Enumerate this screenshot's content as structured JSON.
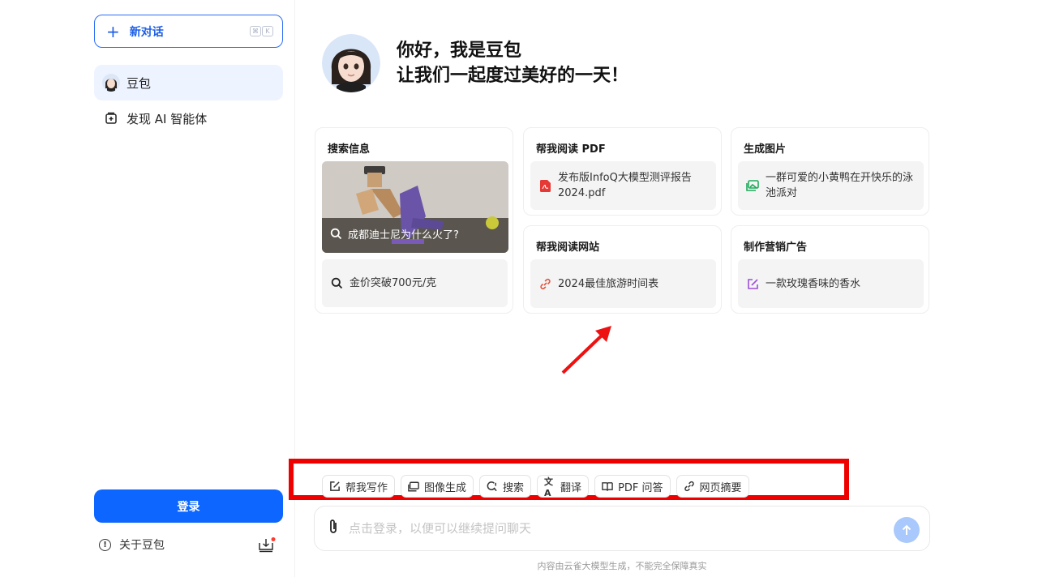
{
  "sidebar": {
    "new_chat_label": "新对话",
    "shortcut_keys": [
      "⌘",
      "K"
    ],
    "items": [
      {
        "label": "豆包",
        "icon": "doubao-avatar"
      },
      {
        "label": "发现 AI 智能体",
        "icon": "agent-store-icon"
      }
    ],
    "login_label": "登录",
    "about_label": "关于豆包",
    "download_icon": "download-app-icon"
  },
  "hero": {
    "line1": "你好，我是豆包",
    "line2": "让我们一起度过美好的一天！"
  },
  "cards": {
    "search": {
      "title": "搜索信息",
      "photo_caption": "成都迪士尼为什么火了?",
      "query2": "金价突破700元/克"
    },
    "pdf": {
      "title": "帮我阅读 PDF",
      "file": "发布版InfoQ大模型测评报告2024.pdf"
    },
    "image": {
      "title": "生成图片",
      "prompt": "一群可爱的小黄鸭在开快乐的泳池派对"
    },
    "web": {
      "title": "帮我阅读网站",
      "link": "2024最佳旅游时间表"
    },
    "ad": {
      "title": "制作营销广告",
      "prompt": "一款玫瑰香味的香水"
    }
  },
  "toolbar": [
    {
      "label": "帮我写作",
      "icon": "edit-icon"
    },
    {
      "label": "图像生成",
      "icon": "image-icon"
    },
    {
      "label": "搜索",
      "icon": "search-icon"
    },
    {
      "label": "翻译",
      "icon": "translate-icon"
    },
    {
      "label": "PDF 问答",
      "icon": "book-icon"
    },
    {
      "label": "网页摘要",
      "icon": "link-icon"
    }
  ],
  "input": {
    "placeholder": "点击登录，以便可以继续提问聊天"
  },
  "footnote": "内容由云雀大模型生成，不能完全保障真实",
  "colors": {
    "accent": "#0c66ff",
    "highlight": "#ee0000"
  }
}
